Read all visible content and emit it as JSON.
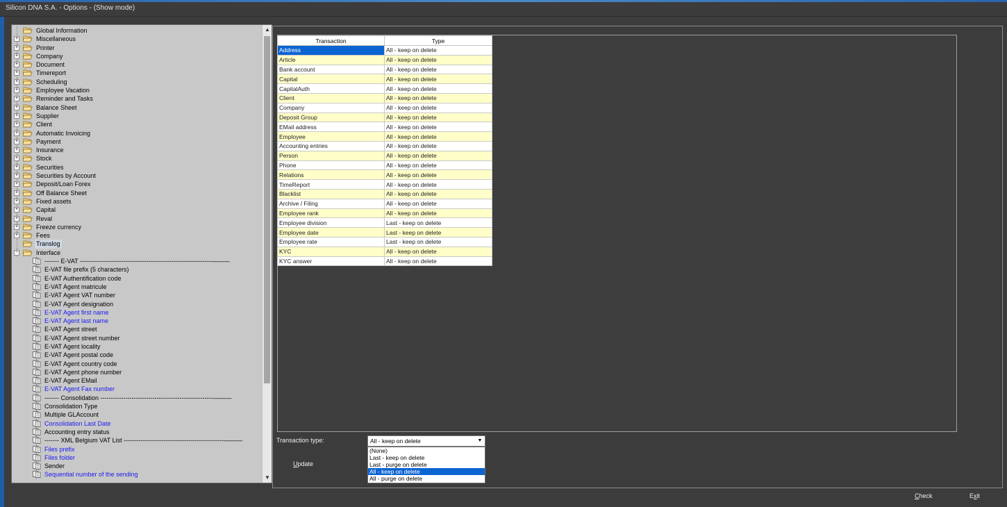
{
  "window": {
    "title": "Silicon DNA S.A. - Options - (Show mode)"
  },
  "tree": {
    "folders": [
      {
        "label": "Global Information",
        "expander": ""
      },
      {
        "label": "Miscellaneous",
        "expander": "+"
      },
      {
        "label": "Printer",
        "expander": "+"
      },
      {
        "label": "Company",
        "expander": "+"
      },
      {
        "label": "Document",
        "expander": "+"
      },
      {
        "label": "Timereport",
        "expander": "+"
      },
      {
        "label": "Scheduling",
        "expander": "+"
      },
      {
        "label": "Employee Vacation",
        "expander": "+"
      },
      {
        "label": "Reminder and Tasks",
        "expander": "+"
      },
      {
        "label": "Balance Sheet",
        "expander": "+"
      },
      {
        "label": "Supplier",
        "expander": "+"
      },
      {
        "label": "Client",
        "expander": "+"
      },
      {
        "label": "Automatic Invoicing",
        "expander": "+"
      },
      {
        "label": "Payment",
        "expander": "+"
      },
      {
        "label": "Insurance",
        "expander": "+"
      },
      {
        "label": "Stock",
        "expander": "+"
      },
      {
        "label": "Securities",
        "expander": "+"
      },
      {
        "label": "Securities by Account",
        "expander": "+"
      },
      {
        "label": "Deposit/Loan Forex",
        "expander": "+"
      },
      {
        "label": "Off Balance Sheet",
        "expander": "+"
      },
      {
        "label": "Fixed assets",
        "expander": "+"
      },
      {
        "label": "Capital",
        "expander": "+"
      },
      {
        "label": "Reval",
        "expander": "+"
      },
      {
        "label": "Freeze currency",
        "expander": "+"
      },
      {
        "label": "Fees",
        "expander": "+"
      },
      {
        "label": "Translog",
        "expander": "",
        "selected": true
      },
      {
        "label": "Interface",
        "expander": "−"
      }
    ],
    "children": [
      {
        "label": "------- E-VAT ---------------------------------------------------------------———",
        "blue": false
      },
      {
        "label": "E-VAT file prefix (5 characters)",
        "blue": false
      },
      {
        "label": "E-VAT Authentification code",
        "blue": false
      },
      {
        "label": "E-VAT Agent matricule",
        "blue": false
      },
      {
        "label": "E-VAT Agent VAT number",
        "blue": false
      },
      {
        "label": "E-VAT Agent designation",
        "blue": false
      },
      {
        "label": "E-VAT Agent first name",
        "blue": true
      },
      {
        "label": "E-VAT Agent last name",
        "blue": true
      },
      {
        "label": "E-VAT Agent street",
        "blue": false
      },
      {
        "label": "E-VAT Agent street number",
        "blue": false
      },
      {
        "label": "E-VAT Agent locality",
        "blue": false
      },
      {
        "label": "E-VAT Agent postal code",
        "blue": false
      },
      {
        "label": "E-VAT Agent country code",
        "blue": false
      },
      {
        "label": "E-VAT Agent phone number",
        "blue": false
      },
      {
        "label": "E-VAT Agent EMail",
        "blue": false
      },
      {
        "label": "E-VAT Agent Fax number",
        "blue": true
      },
      {
        "label": "------- Consolidation ------------------------------------------------------———",
        "blue": false
      },
      {
        "label": "Consolidation Type",
        "blue": false
      },
      {
        "label": "Multiple GLAccount",
        "blue": false
      },
      {
        "label": "Consolidation Last Date",
        "blue": true
      },
      {
        "label": "Accounting entry status",
        "blue": false
      },
      {
        "label": "------- XML Belgium VAT List ------------------------------------------------———",
        "blue": false
      },
      {
        "label": "Files prefix",
        "blue": true
      },
      {
        "label": "Files folder",
        "blue": true
      },
      {
        "label": "Sender",
        "blue": false
      },
      {
        "label": "Sequential number of the sending",
        "blue": true
      }
    ]
  },
  "grid": {
    "headers": {
      "transaction": "Transaction",
      "type": "Type"
    },
    "rows": [
      {
        "transaction": "Address",
        "type": "All - keep on delete",
        "alt": false,
        "selected": true
      },
      {
        "transaction": "Article",
        "type": "All - keep on delete",
        "alt": true
      },
      {
        "transaction": "Bank account",
        "type": "All - keep on delete",
        "alt": false
      },
      {
        "transaction": "Capital",
        "type": "All - keep on delete",
        "alt": true
      },
      {
        "transaction": "CapitalAuth",
        "type": "All - keep on delete",
        "alt": false
      },
      {
        "transaction": "Client",
        "type": "All - keep on delete",
        "alt": true
      },
      {
        "transaction": "Company",
        "type": "All - keep on delete",
        "alt": false
      },
      {
        "transaction": "Deposit Group",
        "type": "All - keep on delete",
        "alt": true
      },
      {
        "transaction": "EMail address",
        "type": "All - keep on delete",
        "alt": false
      },
      {
        "transaction": "Employee",
        "type": "All - keep on delete",
        "alt": true
      },
      {
        "transaction": "Accounting entries",
        "type": "All - keep on delete",
        "alt": false
      },
      {
        "transaction": "Person",
        "type": "All - keep on delete",
        "alt": true
      },
      {
        "transaction": "Phone",
        "type": "All - keep on delete",
        "alt": false
      },
      {
        "transaction": "Relations",
        "type": "All - keep on delete",
        "alt": true
      },
      {
        "transaction": "TimeReport",
        "type": "All - keep on delete",
        "alt": false
      },
      {
        "transaction": "Blacklist",
        "type": "All - keep on delete",
        "alt": true
      },
      {
        "transaction": "Archive / Filing",
        "type": "All - keep on delete",
        "alt": false
      },
      {
        "transaction": "Employee rank",
        "type": "All - keep on delete",
        "alt": true
      },
      {
        "transaction": "Employee division",
        "type": "Last - keep on delete",
        "alt": false
      },
      {
        "transaction": "Employee date",
        "type": "Last - keep on delete",
        "alt": true
      },
      {
        "transaction": "Employee rate",
        "type": "Last - keep on delete",
        "alt": false
      },
      {
        "transaction": "KYC",
        "type": "All - keep on delete",
        "alt": true
      },
      {
        "transaction": "KYC answer",
        "type": "All - keep on delete",
        "alt": false
      }
    ]
  },
  "form": {
    "transaction_type_label": "Transaction type:",
    "combo_value": "All - keep on delete",
    "options": [
      "(None)",
      "Last - keep on delete",
      "Last - purge on delete",
      "All - keep on delete",
      "All - purge on delete"
    ],
    "active_option": "All - keep on delete"
  },
  "buttons": {
    "update_u": "U",
    "update_rest": "pdate",
    "check_u": "C",
    "check_rest": "heck",
    "exit_pre": "E",
    "exit_u": "x",
    "exit_rest": "it"
  },
  "colors": {
    "selection": "#0a64d2",
    "alt_row": "#fffec8",
    "blue_link": "#1a1af0"
  }
}
